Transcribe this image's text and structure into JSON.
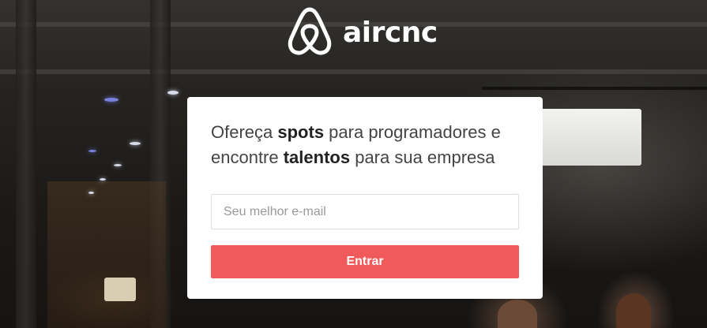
{
  "brand": {
    "name": "aircnc",
    "logo_icon": "airbnb-belo-icon"
  },
  "card": {
    "headline": {
      "part1": "Ofereça ",
      "strong1": "spots",
      "part2": " para programadores e encontre ",
      "strong2": "talentos",
      "part3": " para sua empresa"
    },
    "email_input": {
      "placeholder": "Seu melhor e-mail",
      "value": ""
    },
    "submit_label": "Entrar"
  },
  "colors": {
    "accent": "#f05a5b",
    "card_bg": "#ffffff",
    "text": "#444444",
    "logo": "#ffffff"
  }
}
